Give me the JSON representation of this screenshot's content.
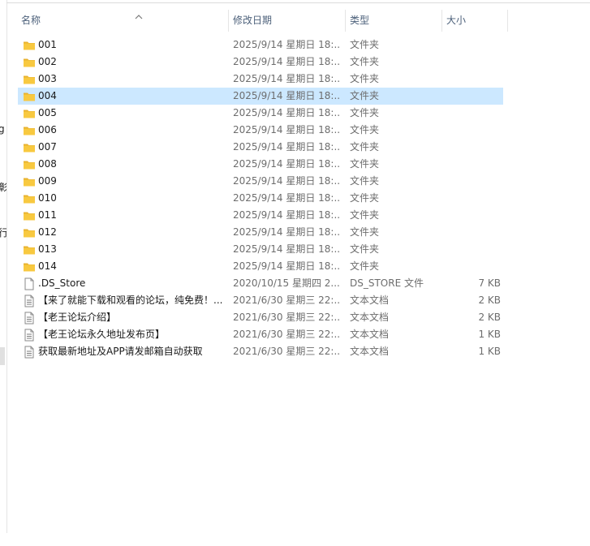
{
  "left_fragments": [
    "g",
    "彰",
    "行"
  ],
  "header": {
    "name": "名称",
    "modified": "修改日期",
    "type": "类型",
    "size": "大小"
  },
  "colors": {
    "selected_row": "#cce8ff",
    "folder_yellow": "#f8c940",
    "header_text": "#4c607a"
  },
  "files": [
    {
      "name": "001",
      "date": "2025/9/14 星期日 18:...",
      "type": "文件夹",
      "size": "",
      "icon": "folder-icon",
      "selected": false
    },
    {
      "name": "002",
      "date": "2025/9/14 星期日 18:...",
      "type": "文件夹",
      "size": "",
      "icon": "folder-icon",
      "selected": false
    },
    {
      "name": "003",
      "date": "2025/9/14 星期日 18:...",
      "type": "文件夹",
      "size": "",
      "icon": "folder-icon",
      "selected": false
    },
    {
      "name": "004",
      "date": "2025/9/14 星期日 18:...",
      "type": "文件夹",
      "size": "",
      "icon": "folder-icon",
      "selected": true
    },
    {
      "name": "005",
      "date": "2025/9/14 星期日 18:...",
      "type": "文件夹",
      "size": "",
      "icon": "folder-icon",
      "selected": false
    },
    {
      "name": "006",
      "date": "2025/9/14 星期日 18:...",
      "type": "文件夹",
      "size": "",
      "icon": "folder-icon",
      "selected": false
    },
    {
      "name": "007",
      "date": "2025/9/14 星期日 18:...",
      "type": "文件夹",
      "size": "",
      "icon": "folder-icon",
      "selected": false
    },
    {
      "name": "008",
      "date": "2025/9/14 星期日 18:...",
      "type": "文件夹",
      "size": "",
      "icon": "folder-icon",
      "selected": false
    },
    {
      "name": "009",
      "date": "2025/9/14 星期日 18:...",
      "type": "文件夹",
      "size": "",
      "icon": "folder-icon",
      "selected": false
    },
    {
      "name": "010",
      "date": "2025/9/14 星期日 18:...",
      "type": "文件夹",
      "size": "",
      "icon": "folder-icon",
      "selected": false
    },
    {
      "name": "011",
      "date": "2025/9/14 星期日 18:...",
      "type": "文件夹",
      "size": "",
      "icon": "folder-icon",
      "selected": false
    },
    {
      "name": "012",
      "date": "2025/9/14 星期日 18:...",
      "type": "文件夹",
      "size": "",
      "icon": "folder-icon",
      "selected": false
    },
    {
      "name": "013",
      "date": "2025/9/14 星期日 18:...",
      "type": "文件夹",
      "size": "",
      "icon": "folder-icon",
      "selected": false
    },
    {
      "name": "014",
      "date": "2025/9/14 星期日 18:...",
      "type": "文件夹",
      "size": "",
      "icon": "folder-icon",
      "selected": false
    },
    {
      "name": ".DS_Store",
      "date": "2020/10/15 星期四 2...",
      "type": "DS_STORE 文件",
      "size": "7 KB",
      "icon": "blank-file-icon",
      "selected": false
    },
    {
      "name": "【来了就能下载和观看的论坛，纯免费！...",
      "date": "2021/6/30 星期三 22:...",
      "type": "文本文档",
      "size": "2 KB",
      "icon": "text-file-icon",
      "selected": false
    },
    {
      "name": "【老王论坛介绍】",
      "date": "2021/6/30 星期三 22:...",
      "type": "文本文档",
      "size": "2 KB",
      "icon": "text-file-icon",
      "selected": false
    },
    {
      "name": "【老王论坛永久地址发布页】",
      "date": "2021/6/30 星期三 22:...",
      "type": "文本文档",
      "size": "1 KB",
      "icon": "text-file-icon",
      "selected": false
    },
    {
      "name": "获取最新地址及APP请发邮箱自动获取",
      "date": "2021/6/30 星期三 22:...",
      "type": "文本文档",
      "size": "1 KB",
      "icon": "text-file-icon",
      "selected": false
    }
  ]
}
